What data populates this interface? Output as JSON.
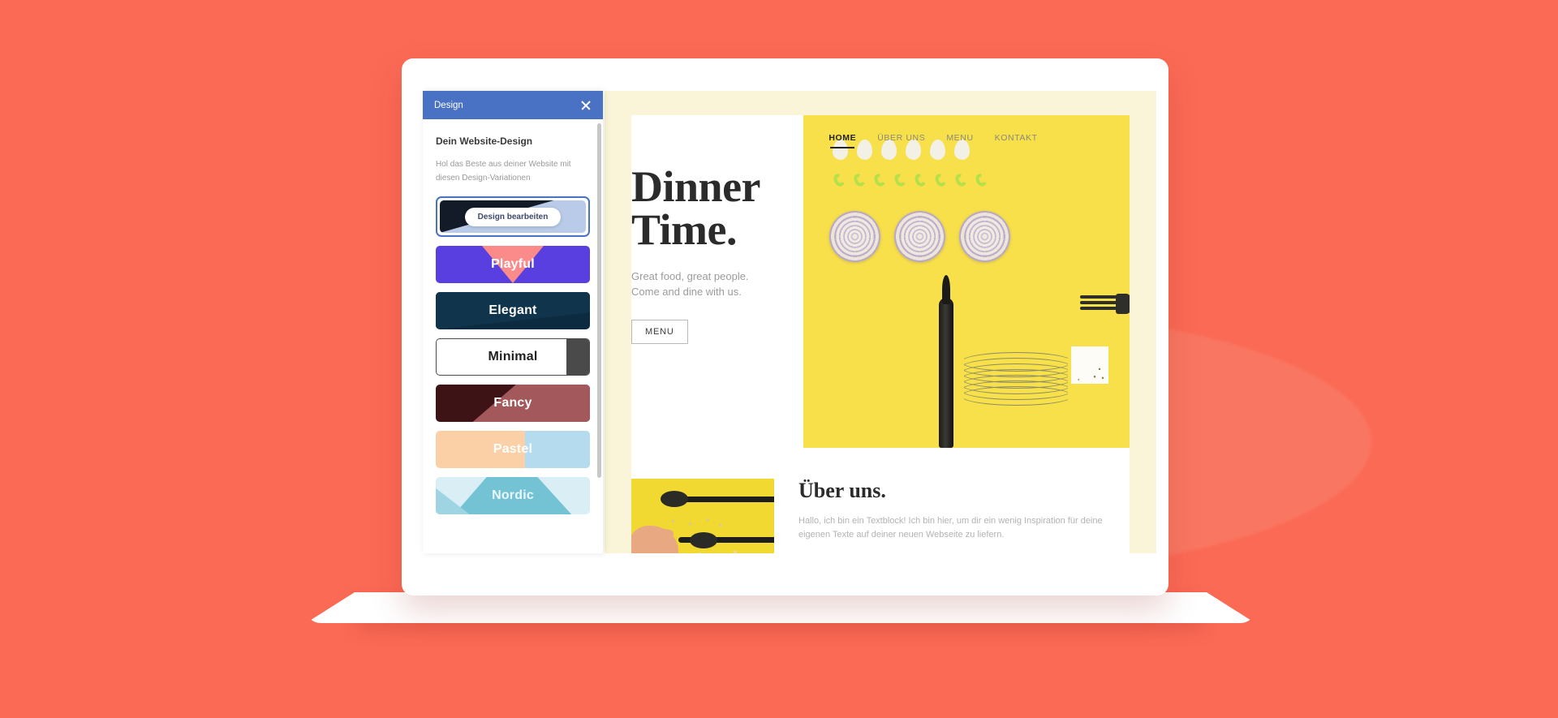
{
  "background": {
    "color": "#fb6a55"
  },
  "panel": {
    "title": "Design",
    "close_icon": "close-icon",
    "heading": "Dein Website-Design",
    "description": "Hol das Beste aus deiner Website mit diesen Design-Variationen",
    "selected_card": {
      "label": "Design bearbeiten",
      "colors": [
        "#131a28",
        "#b9cbe8"
      ],
      "accent": "#4a72c4"
    },
    "cards": [
      {
        "label": "Playful",
        "colors": [
          "#5a3fe0",
          "#fb8b8b"
        ]
      },
      {
        "label": "Elegant",
        "colors": [
          "#0d2b40",
          "#10344b"
        ]
      },
      {
        "label": "Minimal",
        "colors": [
          "#ffffff",
          "#4a4a4a"
        ]
      },
      {
        "label": "Fancy",
        "colors": [
          "#3e1316",
          "#a3585b"
        ]
      },
      {
        "label": "Pastel",
        "colors": [
          "#fbd0a7",
          "#b4dcee"
        ]
      },
      {
        "label": "Nordic",
        "colors": [
          "#d9eef5",
          "#73c3d4"
        ]
      }
    ]
  },
  "preview": {
    "frame_color": "#faf4d8",
    "nav": [
      {
        "label": "HOME",
        "active": true
      },
      {
        "label": "ÜBER UNS",
        "active": false
      },
      {
        "label": "MENU",
        "active": false
      },
      {
        "label": "KONTAKT",
        "active": false
      }
    ],
    "hero": {
      "title_line1": "Dinner",
      "title_line2": "Time.",
      "subtitle_line1": "Great food, great people.",
      "subtitle_line2": "Come and dine with us.",
      "button_label": "MENU",
      "photo_background": "#f7e04a",
      "photo_description": "flat-lay food photo with garlic, peas, onion rings, fork, noodles and seeds"
    },
    "about": {
      "title": "Über uns.",
      "paragraph": "Hallo, ich bin ein Textblock! Ich bin hier, um dir ein wenig Inspiration für deine eigenen Texte auf deiner neuen Webseite zu liefern.",
      "photo_background": "#f1d932",
      "photo_description": "hand holding spoons with grains on yellow background"
    }
  }
}
